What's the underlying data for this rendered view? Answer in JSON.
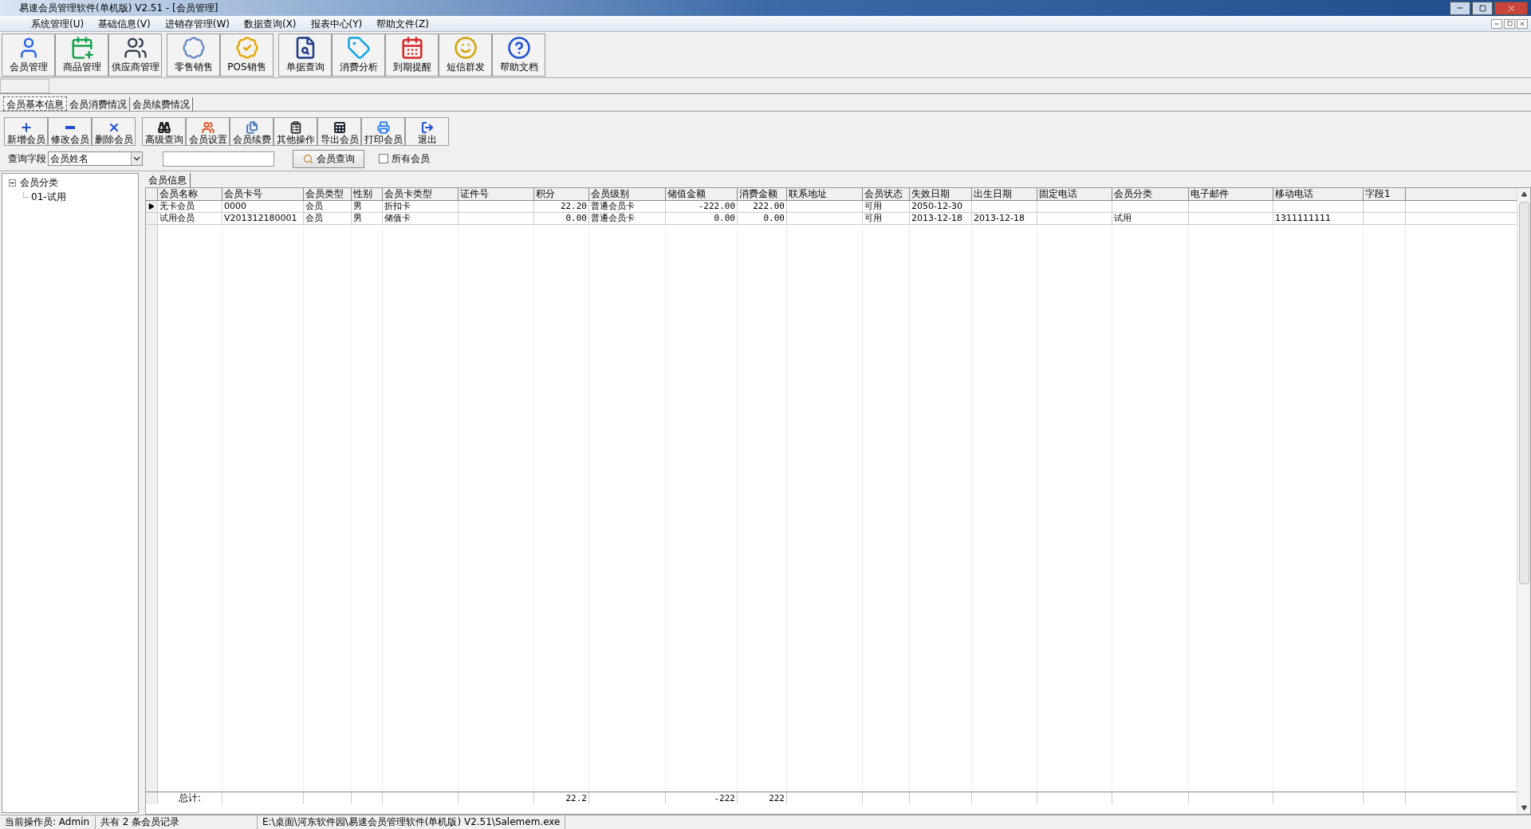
{
  "window": {
    "title": "易速会员管理软件(单机版) V2.51 - [会员管理]"
  },
  "menu": [
    "系统管理(U)",
    "基础信息(V)",
    "进销存管理(W)",
    "数据查询(X)",
    "报表中心(Y)",
    "帮助文件(Z)"
  ],
  "toolbar": [
    [
      "会员管理",
      "商品管理",
      "供应商管理"
    ],
    [
      "零售销售",
      "POS销售"
    ],
    [
      "单据查询",
      "消费分析",
      "到期提醒",
      "短信群发",
      "帮助文档"
    ]
  ],
  "tabs": [
    {
      "label": "会员基本信息",
      "selected": true
    },
    {
      "label": "会员消费情况",
      "selected": false
    },
    {
      "label": "会员续费情况",
      "selected": false
    }
  ],
  "actions": [
    [
      "新增会员",
      "修改会员",
      "删除会员"
    ],
    [
      "高级查询",
      "会员设置",
      "会员续费",
      "其他操作",
      "导出会员",
      "打印会员",
      "退出"
    ]
  ],
  "query": {
    "label": "查询字段",
    "field": "会员姓名",
    "button": "会员查询",
    "all_members": {
      "label": "所有会员",
      "checked": false
    }
  },
  "tree": {
    "label": "会员分类",
    "expanded": true,
    "children": [
      {
        "label": "01-试用"
      }
    ]
  },
  "grid": {
    "tab": "会员信息",
    "columns": [
      "会员名称",
      "会员卡号",
      "会员类型",
      "性别",
      "会员卡类型",
      "证件号",
      "积分",
      "会员级别",
      "储值金额",
      "消费金额",
      "联系地址",
      "会员状态",
      "失效日期",
      "出生日期",
      "固定电话",
      "会员分类",
      "电子邮件",
      "移动电话",
      "字段1"
    ],
    "rows": [
      {
        "selected": true,
        "name": "无卡会员",
        "card_no": "0000",
        "type": "会员",
        "gender": "男",
        "card_type": "折扣卡",
        "points": "22.20",
        "level": "普通会员卡",
        "stored": "-222.00",
        "spent": "222.00",
        "status": "可用",
        "expire": "2050-12-30"
      },
      {
        "selected": false,
        "name": "试用会员",
        "card_no": "V201312180001",
        "type": "会员",
        "gender": "男",
        "card_type": "储值卡",
        "points": "0.00",
        "level": "普通会员卡",
        "stored": "0.00",
        "spent": "0.00",
        "status": "可用",
        "expire": "2013-12-18",
        "birth": "2013-12-18",
        "category": "试用",
        "mobile": "1311111111"
      }
    ],
    "totals": {
      "label": "总计:",
      "points": "22.2",
      "stored": "-222",
      "spent": "222"
    }
  },
  "status_bar": [
    "当前操作员: Admin",
    "共有 2 条会员记录",
    "E:\\桌面\\河东软件园\\易速会员管理软件(单机版) V2.51\\Salemem.exe"
  ]
}
